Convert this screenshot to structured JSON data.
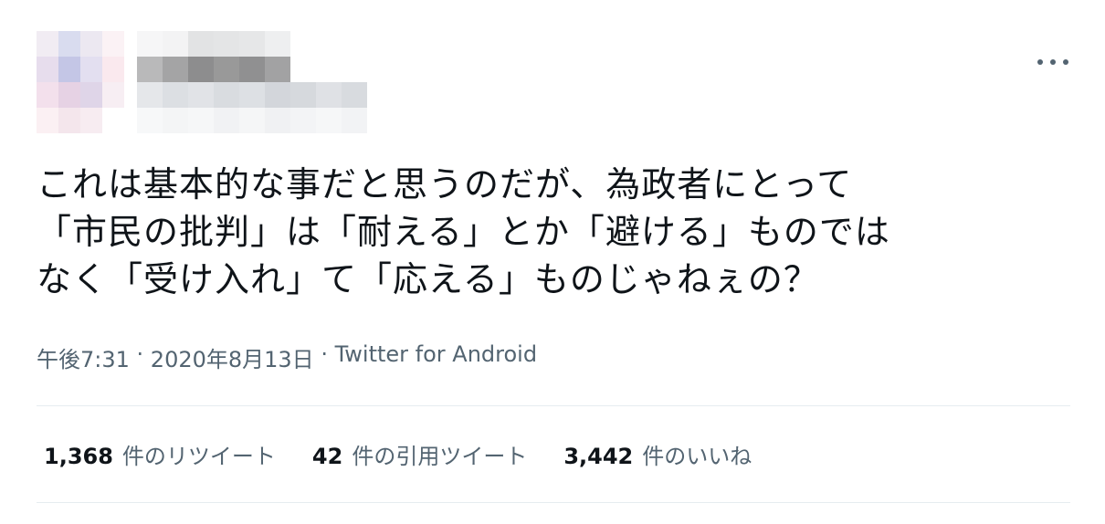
{
  "author": {
    "avatar_colors": [
      [
        "#f1ecf3",
        "#d9dcef",
        "#ece8f1",
        "#fbf2f5"
      ],
      [
        "#e7dded",
        "#c4c6e6",
        "#e3dff0",
        "#fae9ee"
      ],
      [
        "#f3e0ec",
        "#e6d2e4",
        "#dfd5e8",
        "#f7eef3"
      ],
      [
        "#fbf0f3",
        "#f4e6ec",
        "#f7ecf1",
        "#ffffff"
      ]
    ],
    "name_colors": [
      [
        "#f6f6f7",
        "#f3f3f4",
        "#e2e3e4",
        "#e4e5e6",
        "#e6e7e8",
        "#eeeff0",
        "#ffffff",
        "#ffffff",
        "#ffffff"
      ],
      [
        "#b9b9ba",
        "#a4a4a5",
        "#8d8d8e",
        "#999999",
        "#909091",
        "#a2a2a3",
        "#ffffff",
        "#ffffff",
        "#ffffff"
      ],
      [
        "#e5e7ea",
        "#dcdfe3",
        "#e1e3e7",
        "#d9dce0",
        "#dde0e4",
        "#d3d6db",
        "#d6d9dd",
        "#dfe1e5",
        "#d8dbdf"
      ],
      [
        "#f7f8f9",
        "#f4f5f6",
        "#f6f7f8",
        "#f1f2f4",
        "#f5f6f7",
        "#f0f1f3",
        "#f3f4f6",
        "#f6f7f8",
        "#f2f3f5"
      ]
    ]
  },
  "tweet": {
    "text": "これは基本的な事だと思うのだが、為政者にとって\n「市民の批判」は「耐える」とか「避ける」ものでは\nなく「受け入れ」て「応える」ものじゃねぇの？"
  },
  "meta": {
    "time": "午後7:31",
    "separator": " · ",
    "date": "2020年8月13日",
    "source": "Twitter for Android"
  },
  "stats": {
    "retweets": {
      "count": "1,368",
      "label": "件のリツイート"
    },
    "quotes": {
      "count": "42",
      "label": "件の引用ツイート"
    },
    "likes": {
      "count": "3,442",
      "label": "件のいいね"
    }
  },
  "icons": {
    "more": "more-options-icon"
  }
}
